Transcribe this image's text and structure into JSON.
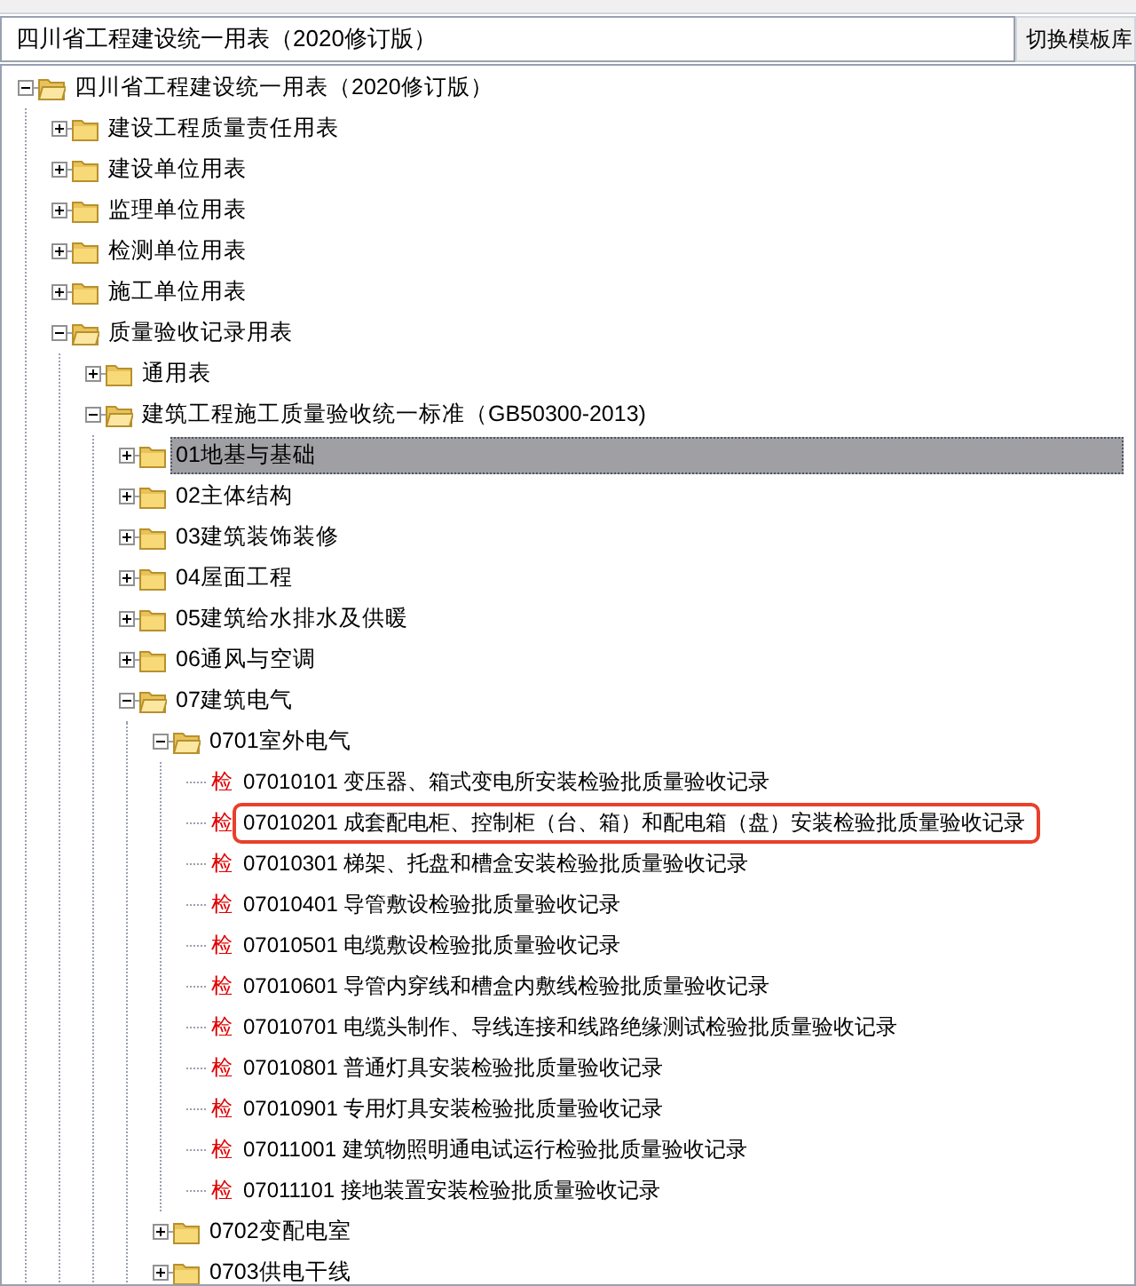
{
  "combo": {
    "value": "四川省工程建设统一用表（2020修订版）"
  },
  "switch_button": "切换模板库",
  "tree": [
    {
      "kind": "folder",
      "label": "四川省工程建设统一用表（2020修订版）",
      "expanded": true,
      "selected": false,
      "children": [
        {
          "kind": "folder",
          "label": "建设工程质量责任用表",
          "expanded": false,
          "selected": false
        },
        {
          "kind": "folder",
          "label": "建设单位用表",
          "expanded": false,
          "selected": false
        },
        {
          "kind": "folder",
          "label": "监理单位用表",
          "expanded": false,
          "selected": false
        },
        {
          "kind": "folder",
          "label": "检测单位用表",
          "expanded": false,
          "selected": false
        },
        {
          "kind": "folder",
          "label": "施工单位用表",
          "expanded": false,
          "selected": false
        },
        {
          "kind": "folder",
          "label": "质量验收记录用表",
          "expanded": true,
          "selected": false,
          "children": [
            {
              "kind": "folder",
              "label": "通用表",
              "expanded": false,
              "selected": false
            },
            {
              "kind": "folder",
              "label": "建筑工程施工质量验收统一标准（GB50300-2013)",
              "expanded": true,
              "selected": false,
              "children": [
                {
                  "kind": "folder",
                  "label": "01地基与基础",
                  "expanded": false,
                  "selected": true
                },
                {
                  "kind": "folder",
                  "label": "02主体结构",
                  "expanded": false,
                  "selected": false
                },
                {
                  "kind": "folder",
                  "label": "03建筑装饰装修",
                  "expanded": false,
                  "selected": false
                },
                {
                  "kind": "folder",
                  "label": "04屋面工程",
                  "expanded": false,
                  "selected": false
                },
                {
                  "kind": "folder",
                  "label": "05建筑给水排水及供暖",
                  "expanded": false,
                  "selected": false
                },
                {
                  "kind": "folder",
                  "label": "06通风与空调",
                  "expanded": false,
                  "selected": false
                },
                {
                  "kind": "folder",
                  "label": "07建筑电气",
                  "expanded": true,
                  "selected": false,
                  "children": [
                    {
                      "kind": "folder",
                      "label": "0701室外电气",
                      "expanded": true,
                      "selected": false,
                      "children": [
                        {
                          "kind": "form",
                          "badge": "检",
                          "label": "07010101 变压器、箱式变电所安装检验批质量验收记录",
                          "selected": false,
                          "annotated": false
                        },
                        {
                          "kind": "form",
                          "badge": "检",
                          "label": "07010201 成套配电柜、控制柜（台、箱）和配电箱（盘）安装检验批质量验收记录",
                          "selected": false,
                          "annotated": true
                        },
                        {
                          "kind": "form",
                          "badge": "检",
                          "label": "07010301 梯架、托盘和槽盒安装检验批质量验收记录",
                          "selected": false,
                          "annotated": false
                        },
                        {
                          "kind": "form",
                          "badge": "检",
                          "label": "07010401 导管敷设检验批质量验收记录",
                          "selected": false,
                          "annotated": false
                        },
                        {
                          "kind": "form",
                          "badge": "检",
                          "label": "07010501 电缆敷设检验批质量验收记录",
                          "selected": false,
                          "annotated": false
                        },
                        {
                          "kind": "form",
                          "badge": "检",
                          "label": "07010601 导管内穿线和槽盒内敷线检验批质量验收记录",
                          "selected": false,
                          "annotated": false
                        },
                        {
                          "kind": "form",
                          "badge": "检",
                          "label": "07010701 电缆头制作、导线连接和线路绝缘测试检验批质量验收记录",
                          "selected": false,
                          "annotated": false
                        },
                        {
                          "kind": "form",
                          "badge": "检",
                          "label": "07010801 普通灯具安装检验批质量验收记录",
                          "selected": false,
                          "annotated": false
                        },
                        {
                          "kind": "form",
                          "badge": "检",
                          "label": "07010901 专用灯具安装检验批质量验收记录",
                          "selected": false,
                          "annotated": false
                        },
                        {
                          "kind": "form",
                          "badge": "检",
                          "label": "07011001 建筑物照明通电试运行检验批质量验收记录",
                          "selected": false,
                          "annotated": false
                        },
                        {
                          "kind": "form",
                          "badge": "检",
                          "label": "07011101 接地装置安装检验批质量验收记录",
                          "selected": false,
                          "annotated": false
                        }
                      ]
                    },
                    {
                      "kind": "folder",
                      "label": "0702变配电室",
                      "expanded": false,
                      "selected": false
                    },
                    {
                      "kind": "folder",
                      "label": "0703供电干线",
                      "expanded": false,
                      "selected": false
                    }
                  ]
                }
              ]
            }
          ]
        }
      ]
    }
  ]
}
